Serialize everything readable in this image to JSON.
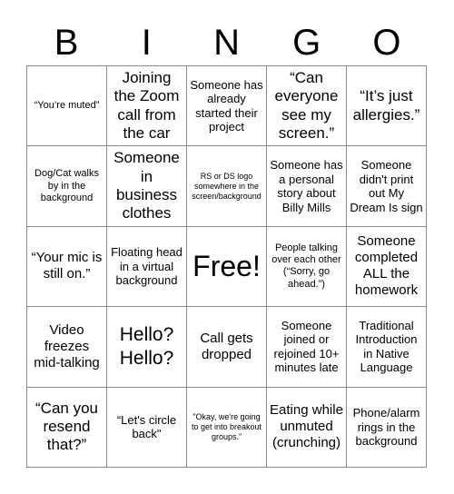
{
  "header": {
    "letters": [
      "B",
      "I",
      "N",
      "G",
      "O"
    ]
  },
  "grid": {
    "columns": 5,
    "rows": 5,
    "border_color": "#8a8a8a",
    "background_color": "#ffffff",
    "text_color": "#000000",
    "cells": [
      {
        "text": "“You’re muted”",
        "size": "s",
        "free": false
      },
      {
        "text": "Joining the Zoom call from the car",
        "size": "xl",
        "free": false
      },
      {
        "text": "Someone has already started their project",
        "size": "m",
        "free": false
      },
      {
        "text": "“Can everyone see my screen.”",
        "size": "xl",
        "free": false
      },
      {
        "text": "“It’s just allergies.”",
        "size": "xl",
        "free": false
      },
      {
        "text": "Dog/Cat walks by in the background",
        "size": "s",
        "free": false
      },
      {
        "text": "Someone in business clothes",
        "size": "xl",
        "free": false
      },
      {
        "text": "RS or DS logo somewhere in the screen/background",
        "size": "xs",
        "free": false
      },
      {
        "text": "Someone has a personal story about Billy Mills",
        "size": "m",
        "free": false
      },
      {
        "text": "Someone didn't print out My Dream Is sign",
        "size": "m",
        "free": false
      },
      {
        "text": "“Your mic is still on.”",
        "size": "l",
        "free": false
      },
      {
        "text": "Floating head in a virtual background",
        "size": "m",
        "free": false
      },
      {
        "text": "Free!",
        "size": "free",
        "free": true
      },
      {
        "text": "People talking over each other (“Sorry, go ahead.”)",
        "size": "s",
        "free": false
      },
      {
        "text": "Someone completed ALL the homework",
        "size": "l",
        "free": false
      },
      {
        "text": "Video freezes mid-talking",
        "size": "l",
        "free": false
      },
      {
        "text": "Hello? Hello?",
        "size": "2xl",
        "free": false
      },
      {
        "text": "Call gets dropped",
        "size": "l",
        "free": false
      },
      {
        "text": "Someone joined or rejoined 10+ minutes late",
        "size": "m",
        "free": false
      },
      {
        "text": "Traditional Introduction in Native Language",
        "size": "m",
        "free": false
      },
      {
        "text": "“Can you resend that?”",
        "size": "xl",
        "free": false
      },
      {
        "text": "“Let's circle back\"",
        "size": "m",
        "free": false
      },
      {
        "text": "\"Okay, we're going to get into breakout groups.”",
        "size": "xs",
        "free": false
      },
      {
        "text": "Eating while unmuted (crunching)",
        "size": "l",
        "free": false
      },
      {
        "text": "Phone/alarm rings in the background",
        "size": "m",
        "free": false
      }
    ]
  }
}
